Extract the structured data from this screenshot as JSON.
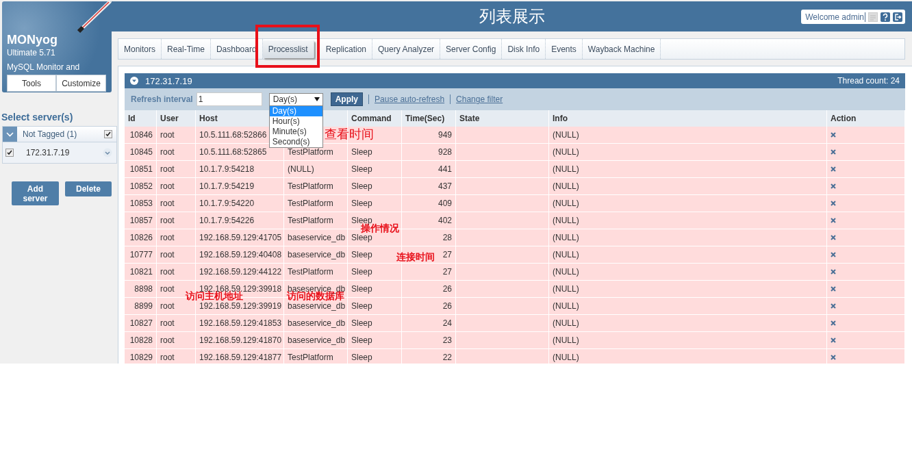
{
  "app": {
    "name": "MONyog",
    "edition": "Ultimate 5.71",
    "tagline": "MySQL Monitor and",
    "buttons": [
      "Tools",
      "Customize"
    ]
  },
  "header": {
    "title": "列表展示",
    "welcome": "Welcome admin"
  },
  "sidebar": {
    "title": "Select server(s)",
    "group": {
      "label": "Not Tagged (1)",
      "checked": true,
      "expanded": true
    },
    "servers": [
      {
        "name": "172.31.7.19",
        "checked": true
      }
    ],
    "buttons": [
      "Add server",
      "Delete"
    ]
  },
  "tabs": [
    {
      "label": "Monitors",
      "selected": false
    },
    {
      "label": "Real-Time",
      "selected": false
    },
    {
      "label": "Dashboard",
      "selected": false
    },
    {
      "label": "Processlist",
      "selected": true
    },
    {
      "label": "Replication",
      "selected": false
    },
    {
      "label": "Query Analyzer",
      "selected": false
    },
    {
      "label": "Server Config",
      "selected": false
    },
    {
      "label": "Disk Info",
      "selected": false
    },
    {
      "label": "Events",
      "selected": false
    },
    {
      "label": "Wayback Machine",
      "selected": false
    }
  ],
  "panel": {
    "server": "172.31.7.19",
    "thread_count": "Thread count: 24",
    "filter": {
      "label": "Refresh interval",
      "value": "1",
      "unit": "Day(s)",
      "options": [
        {
          "label": "Day(s)",
          "selected": true
        },
        {
          "label": "Hour(s)",
          "selected": false
        },
        {
          "label": "Minute(s)",
          "selected": false
        },
        {
          "label": "Second(s)",
          "selected": false
        }
      ],
      "apply": "Apply",
      "links": [
        "Pause auto-refresh",
        "Change filter"
      ]
    },
    "table": {
      "columns": [
        "Id",
        "User",
        "Host",
        null,
        "Command",
        "Time(Sec)",
        "State",
        "Info",
        "Action"
      ],
      "rows": [
        {
          "id": "10846",
          "user": "root",
          "host": "10.5.111.68:52866",
          "time": "949",
          "info": "(NULL)"
        },
        {
          "id": "10845",
          "user": "root",
          "host": "10.5.111.68:52865",
          "db": "TestPlatform",
          "command": "Sleep",
          "time": "928",
          "info": "(NULL)"
        },
        {
          "id": "10851",
          "user": "root",
          "host": "10.1.7.9:54218",
          "db": "(NULL)",
          "command": "Sleep",
          "time": "441",
          "info": "(NULL)"
        },
        {
          "id": "10852",
          "user": "root",
          "host": "10.1.7.9:54219",
          "db": "TestPlatform",
          "command": "Sleep",
          "time": "437",
          "info": "(NULL)"
        },
        {
          "id": "10853",
          "user": "root",
          "host": "10.1.7.9:54220",
          "db": "TestPlatform",
          "command": "Sleep",
          "time": "409",
          "info": "(NULL)"
        },
        {
          "id": "10857",
          "user": "root",
          "host": "10.1.7.9:54226",
          "db": "TestPlatform",
          "command": "Sleep",
          "time": "402",
          "info": "(NULL)"
        },
        {
          "id": "10826",
          "user": "root",
          "host": "192.168.59.129:41705",
          "db": "baseservice_db",
          "command": "Sleep",
          "time": "28",
          "info": "(NULL)"
        },
        {
          "id": "10777",
          "user": "root",
          "host": "192.168.59.129:40408",
          "db": "baseservice_db",
          "command": "Sleep",
          "time": "27",
          "info": "(NULL)"
        },
        {
          "id": "10821",
          "user": "root",
          "host": "192.168.59.129:44122",
          "db": "TestPlatform",
          "command": "Sleep",
          "time": "27",
          "info": "(NULL)"
        },
        {
          "id": "8898",
          "user": "root",
          "host": "192.168.59.129:39918",
          "db": "baseservice_db",
          "command": "Sleep",
          "time": "26",
          "info": "(NULL)"
        },
        {
          "id": "8899",
          "user": "root",
          "host": "192.168.59.129:39919",
          "db": "baseservice_db",
          "command": "Sleep",
          "time": "26",
          "info": "(NULL)"
        },
        {
          "id": "10827",
          "user": "root",
          "host": "192.168.59.129:41853",
          "db": "baseservice_db",
          "command": "Sleep",
          "time": "24",
          "info": "(NULL)"
        },
        {
          "id": "10828",
          "user": "root",
          "host": "192.168.59.129:41870",
          "db": "baseservice_db",
          "command": "Sleep",
          "time": "23",
          "info": "(NULL)"
        },
        {
          "id": "10829",
          "user": "root",
          "host": "192.168.59.129:41877",
          "db": "TestPlatform",
          "command": "Sleep",
          "time": "22",
          "info": "(NULL)"
        }
      ]
    }
  },
  "annotations": [
    {
      "text": "查看时间",
      "kind": "large"
    },
    {
      "text": "操作情况",
      "kind": "bold"
    },
    {
      "text": "连接时间",
      "kind": "bold"
    },
    {
      "text": "访问主机地址",
      "kind": "bold"
    },
    {
      "text": "访问的数据库",
      "kind": "bold"
    }
  ]
}
